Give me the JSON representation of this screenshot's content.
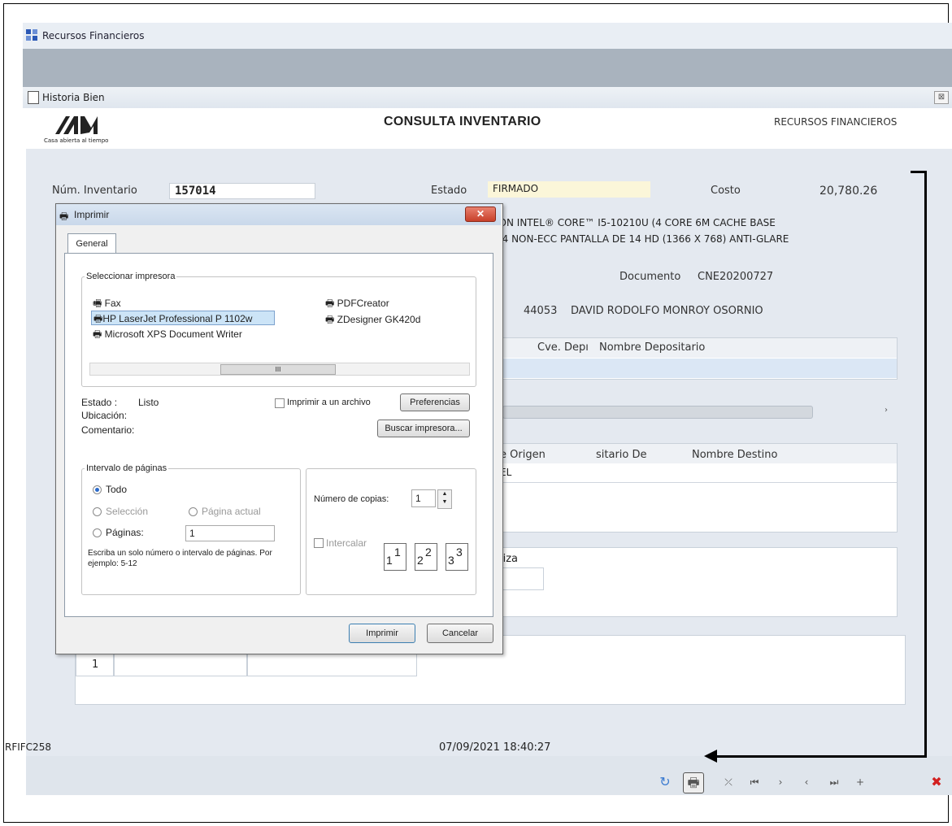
{
  "outer_window": {
    "title": "Recursos Financieros"
  },
  "inner_window": {
    "title": "Historia Bien",
    "close": "⊠"
  },
  "header": {
    "logo_caption": "Casa abierta al tiempo",
    "title": "CONSULTA INVENTARIO",
    "right": "RECURSOS FINANCIEROS"
  },
  "form": {
    "inventory_label": "Núm. Inventario",
    "inventory_value": "157014",
    "estado_label": "Estado",
    "estado_value": "FIRMADO",
    "costo_label": "Costo",
    "costo_value": "20,780.26",
    "desc_line1": "ION INTEL® CORE™ I5-10210U (4 CORE 6M CACHE BASE",
    "desc_line2": "24 NON-ECC PANTALLA DE 14 HD (1366 X 768) ANTI-GLARE",
    "documento_label": "Documento",
    "documento_value": "CNE20200727",
    "depositario_num": "44053",
    "depositario_name": "DAVID RODOLFO MONROY OSORNIO",
    "grid1": {
      "col1": "Cve. Depı",
      "col2": "Nombre Depositario"
    },
    "grid2": {
      "col1": "e Origen",
      "col2": "sitario De",
      "col3": "Nombre Destino",
      "row1": "EL"
    },
    "grid3": {
      "col1": "liza"
    },
    "grid4": {
      "row_num": "1"
    }
  },
  "footer": {
    "code": "RFIFC258",
    "datetime": "07/09/2021 18:40:27"
  },
  "toolbar": {
    "refresh": "↻",
    "print": "🖶",
    "delete": "✖",
    "nav_buttons": [
      "⤫",
      "⏮",
      "›",
      "‹",
      "⏭",
      "+"
    ]
  },
  "print_dialog": {
    "title": "Imprimir",
    "close": "✕",
    "tab": "General",
    "select_printer_label": "Seleccionar impresora",
    "printers": [
      "Fax",
      "PDFCreator",
      "HP LaserJet Professional P 1102w",
      "ZDesigner GK420d",
      "Microsoft XPS Document Writer"
    ],
    "selected_printer": "HP LaserJet Professional P 1102w",
    "scroll_mid": "III",
    "estado_label": "Estado :",
    "estado_value": "Listo",
    "ubicacion_label": "Ubicación:",
    "comentario_label": "Comentario:",
    "print_to_file": "Imprimir a un archivo",
    "preferences_button": "Preferencias",
    "find_printer_button": "Buscar impresora...",
    "page_range_label": "Intervalo de páginas",
    "all": "Todo",
    "selection": "Selección",
    "current_page": "Página actual",
    "pages": "Páginas:",
    "pages_value": "1",
    "hint": "Escriba un solo número o intervalo de páginas. Por ejemplo: 5-12",
    "copies_label": "Número de copias:",
    "copies_value": "1",
    "collate": "Intercalar",
    "collate_pages": [
      "1",
      "1",
      "2",
      "2",
      "3",
      "3"
    ],
    "print_button": "Imprimir",
    "cancel_button": "Cancelar"
  }
}
